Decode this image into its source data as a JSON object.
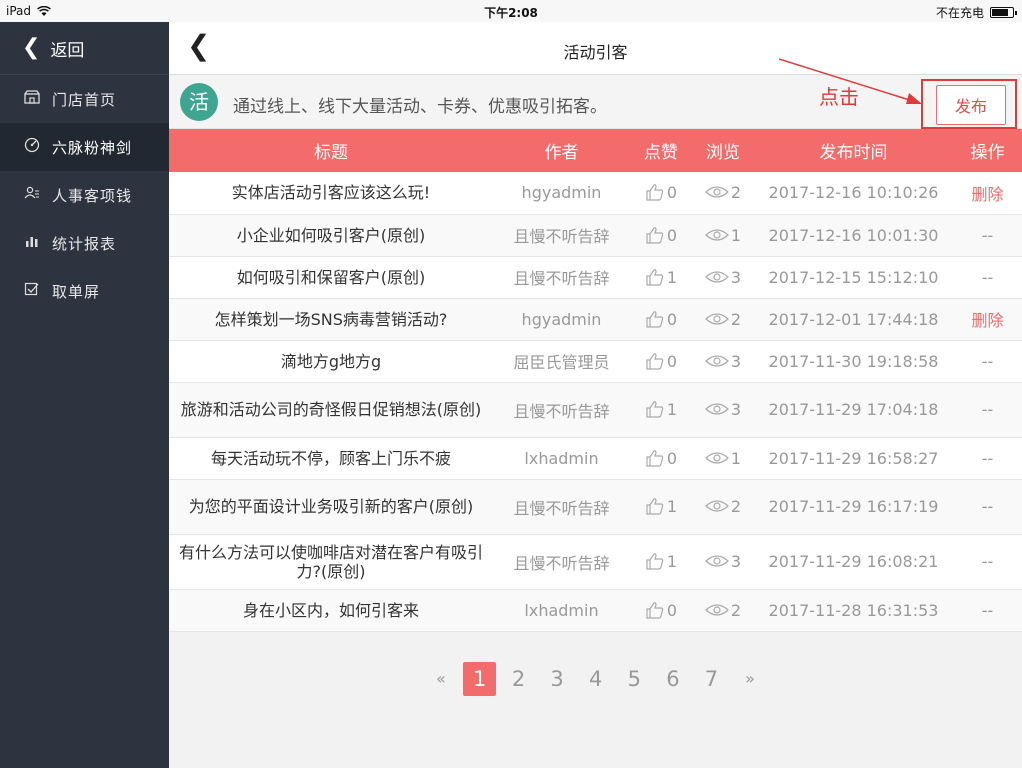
{
  "status_bar": {
    "device": "iPad",
    "time": "下午2:08",
    "charging": "不在充电"
  },
  "sidebar": {
    "back_label": "返回",
    "items": [
      {
        "label": "门店首页",
        "icon": "store-icon",
        "active": false
      },
      {
        "label": "六脉粉神剑",
        "icon": "target-icon",
        "active": true
      },
      {
        "label": "人事客项钱",
        "icon": "people-icon",
        "active": false
      },
      {
        "label": "统计报表",
        "icon": "bar-chart-icon",
        "active": false
      },
      {
        "label": "取单屏",
        "icon": "checkbox-icon",
        "active": false
      }
    ]
  },
  "header": {
    "title": "活动引客"
  },
  "info": {
    "badge": "活",
    "text": "通过线上、线下大量活动、卡券、优惠吸引拓客。",
    "annotation": "点击",
    "publish_label": "发布"
  },
  "table": {
    "columns": [
      "标题",
      "作者",
      "点赞",
      "浏览",
      "发布时间",
      "操作"
    ],
    "rows": [
      {
        "title": "实体店活动引客应该这么玩!",
        "author": "hgyadmin",
        "likes": "0",
        "views": "2",
        "time": "2017-12-16 10:10:26",
        "op": "删除"
      },
      {
        "title": "小企业如何吸引客户(原创)",
        "author": "且慢不听告辞",
        "likes": "0",
        "views": "1",
        "time": "2017-12-16 10:01:30",
        "op": "--"
      },
      {
        "title": "如何吸引和保留客户(原创)",
        "author": "且慢不听告辞",
        "likes": "1",
        "views": "3",
        "time": "2017-12-15 15:12:10",
        "op": "--"
      },
      {
        "title": "怎样策划一场SNS病毒营销活动?",
        "author": "hgyadmin",
        "likes": "0",
        "views": "2",
        "time": "2017-12-01 17:44:18",
        "op": "删除"
      },
      {
        "title": "滴地方g地方g",
        "author": "屈臣氏管理员",
        "likes": "0",
        "views": "3",
        "time": "2017-11-30 19:18:58",
        "op": "--"
      },
      {
        "title": "旅游和活动公司的奇怪假日促销想法(原创)",
        "author": "且慢不听告辞",
        "likes": "1",
        "views": "3",
        "time": "2017-11-29 17:04:18",
        "op": "--"
      },
      {
        "title": "每天活动玩不停，顾客上门乐不疲",
        "author": "lxhadmin",
        "likes": "0",
        "views": "1",
        "time": "2017-11-29 16:58:27",
        "op": "--"
      },
      {
        "title": "为您的平面设计业务吸引新的客户(原创)",
        "author": "且慢不听告辞",
        "likes": "1",
        "views": "2",
        "time": "2017-11-29 16:17:19",
        "op": "--"
      },
      {
        "title": "有什么方法可以使咖啡店对潜在客户有吸引力?(原创)",
        "author": "且慢不听告辞",
        "likes": "1",
        "views": "3",
        "time": "2017-11-29 16:08:21",
        "op": "--"
      },
      {
        "title": "身在小区内，如何引客来",
        "author": "lxhadmin",
        "likes": "0",
        "views": "2",
        "time": "2017-11-28 16:31:53",
        "op": "--"
      }
    ]
  },
  "pagination": {
    "prev": "«",
    "pages": [
      "1",
      "2",
      "3",
      "4",
      "5",
      "6",
      "7"
    ],
    "current": "1",
    "next": "»"
  },
  "colors": {
    "accent": "#f36b6b",
    "sidebar_bg": "#2d3440",
    "badge_green": "#3fa592",
    "annotation_red": "#e13a3a"
  }
}
